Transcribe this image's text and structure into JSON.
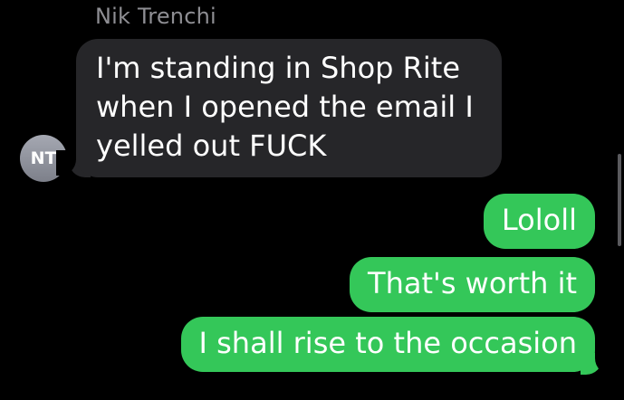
{
  "conversation": {
    "sender_name": "Nik Trenchi",
    "sender_initials": "NT"
  },
  "messages": [
    {
      "direction": "incoming",
      "lines": [
        "I'm standing in Shop Rite",
        "when I opened the email I",
        "yelled out FUCK"
      ]
    },
    {
      "direction": "outgoing",
      "text": "Lololl"
    },
    {
      "direction": "outgoing",
      "text": "That's worth it"
    },
    {
      "direction": "outgoing",
      "text": "I shall rise to the occasion"
    }
  ],
  "colors": {
    "background": "#000000",
    "incoming_bubble": "#262629",
    "outgoing_bubble": "#34c759",
    "sender_name": "#8e8e93"
  }
}
